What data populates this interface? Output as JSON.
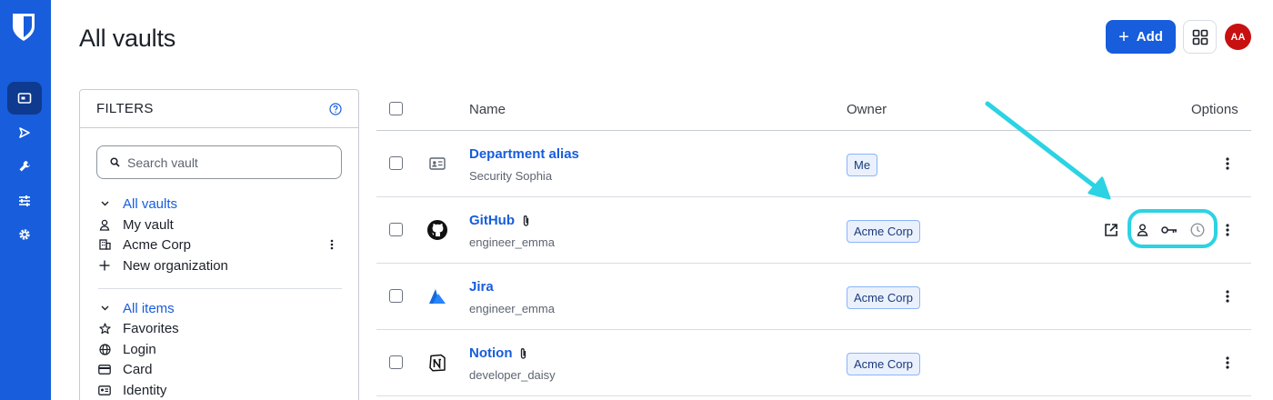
{
  "nav": {
    "items": [
      {
        "name": "vault",
        "icon": "vault-icon",
        "active": true
      },
      {
        "name": "send",
        "icon": "send-icon",
        "active": false
      },
      {
        "name": "tools",
        "icon": "wrench-icon",
        "active": false
      },
      {
        "name": "reports",
        "icon": "sliders-icon",
        "active": false
      },
      {
        "name": "settings",
        "icon": "gear-icon",
        "active": false
      }
    ]
  },
  "header": {
    "title": "All vaults",
    "add_label": "Add",
    "avatar_initials": "AA"
  },
  "filters": {
    "title": "FILTERS",
    "search_placeholder": "Search vault",
    "vaults_header": "All vaults",
    "vaults": [
      "My vault",
      "Acme Corp",
      "New organization"
    ],
    "items_header": "All items",
    "types": [
      "Favorites",
      "Login",
      "Card",
      "Identity"
    ]
  },
  "table": {
    "headers": {
      "name": "Name",
      "owner": "Owner",
      "options": "Options"
    },
    "rows": [
      {
        "name": "Department alias",
        "sub": "Security Sophia",
        "owner": "Me",
        "icon": "id-card-icon",
        "attachment": false
      },
      {
        "name": "GitHub",
        "sub": "engineer_emma",
        "owner": "Acme Corp",
        "icon": "github-icon",
        "attachment": true
      },
      {
        "name": "Jira",
        "sub": "engineer_emma",
        "owner": "Acme Corp",
        "icon": "jira-icon",
        "attachment": false
      },
      {
        "name": "Notion",
        "sub": "developer_daisy",
        "owner": "Acme Corp",
        "icon": "notion-icon",
        "attachment": true
      }
    ]
  },
  "colors": {
    "brand": "#175ddc",
    "highlight": "#2bd3e3",
    "avatar": "#c81010"
  }
}
